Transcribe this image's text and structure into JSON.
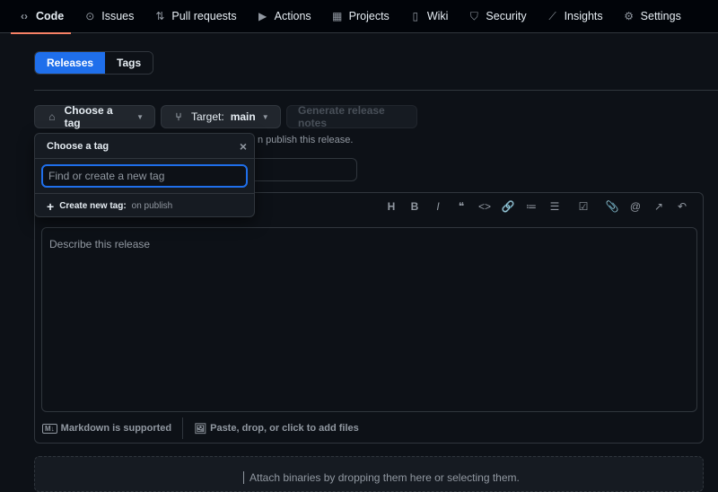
{
  "nav": [
    {
      "label": "Code",
      "icon": "code-icon",
      "glyph": "‹›"
    },
    {
      "label": "Issues",
      "icon": "issue-icon",
      "glyph": "⊙"
    },
    {
      "label": "Pull requests",
      "icon": "pull-request-icon",
      "glyph": "⇅"
    },
    {
      "label": "Actions",
      "icon": "play-icon",
      "glyph": "▶"
    },
    {
      "label": "Projects",
      "icon": "table-icon",
      "glyph": "▦"
    },
    {
      "label": "Wiki",
      "icon": "book-icon",
      "glyph": "▯"
    },
    {
      "label": "Security",
      "icon": "shield-icon",
      "glyph": "⛉"
    },
    {
      "label": "Insights",
      "icon": "graph-icon",
      "glyph": "⟋"
    },
    {
      "label": "Settings",
      "icon": "gear-icon",
      "glyph": "⚙"
    }
  ],
  "tabs": {
    "releases": "Releases",
    "tags": "Tags"
  },
  "actions": {
    "choose_tag": "Choose a tag",
    "target_label": "Target:",
    "target_value": "main",
    "generate": "Generate release notes"
  },
  "hint": "n publish this release.",
  "popover": {
    "title": "Choose a tag",
    "placeholder": "Find or create a new tag",
    "create_label": "Create new tag:",
    "create_suffix": "on publish"
  },
  "editor": {
    "placeholder": "Describe this release",
    "toolbar": [
      "H",
      "B",
      "I",
      "❝",
      "<>",
      "🔗",
      "≔",
      "☰",
      "☑",
      "📎",
      "@",
      "↗",
      "↶"
    ],
    "markdown": "Markdown is supported",
    "attach": "Paste, drop, or click to add files"
  },
  "drop": "Attach binaries by dropping them here or selecting them."
}
